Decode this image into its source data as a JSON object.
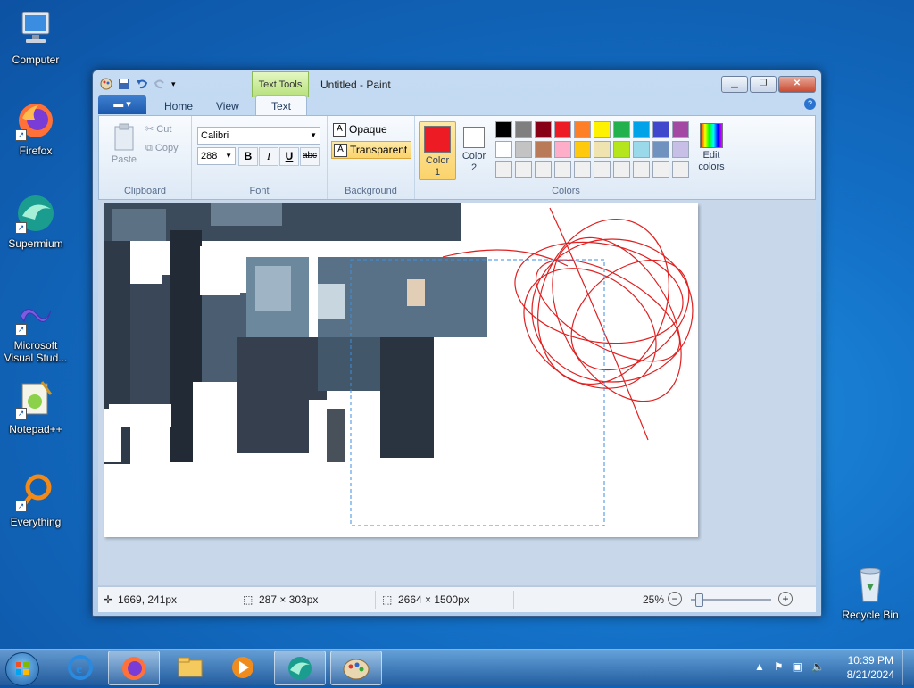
{
  "desktop": {
    "icons": [
      {
        "label": "Computer",
        "icon": "computer-icon"
      },
      {
        "label": "Firefox",
        "icon": "firefox-icon"
      },
      {
        "label": "Supermium",
        "icon": "supermium-icon"
      },
      {
        "label": "Microsoft Visual Stud...",
        "icon": "visual-studio-icon"
      },
      {
        "label": "Notepad++",
        "icon": "notepadpp-icon"
      },
      {
        "label": "Everything",
        "icon": "everything-icon"
      },
      {
        "label": "Recycle Bin",
        "icon": "recycle-bin-icon"
      }
    ]
  },
  "window": {
    "title": "Untitled - Paint",
    "context_tab": "Text Tools",
    "tabs": [
      "Home",
      "View",
      "Text"
    ],
    "active_tab": "Text",
    "help": "?"
  },
  "ribbon": {
    "clipboard": {
      "label": "Clipboard",
      "paste": "Paste",
      "cut": "Cut",
      "copy": "Copy"
    },
    "font": {
      "label": "Font",
      "family": "Calibri",
      "size": "288",
      "bold": "B",
      "italic": "I",
      "underline": "U",
      "strike": "abc"
    },
    "background": {
      "label": "Background",
      "opaque": "Opaque",
      "transparent": "Transparent",
      "selected": "Transparent"
    },
    "colors": {
      "label": "Colors",
      "color1_label": "Color 1",
      "color2_label": "Color 2",
      "color1": "#ed1c24",
      "color2": "#ffffff",
      "edit_label": "Edit colors",
      "palette": [
        "#000000",
        "#7f7f7f",
        "#880015",
        "#ed1c24",
        "#ff7f27",
        "#fff200",
        "#22b14c",
        "#00a2e8",
        "#3f48cc",
        "#a349a4",
        "#ffffff",
        "#c3c3c3",
        "#b97a57",
        "#ffaec9",
        "#ffc90e",
        "#efe4b0",
        "#b5e61d",
        "#99d9ea",
        "#7092be",
        "#c8bfe7",
        "#f0f0f0",
        "#f0f0f0",
        "#f0f0f0",
        "#f0f0f0",
        "#f0f0f0",
        "#f0f0f0",
        "#f0f0f0",
        "#f0f0f0",
        "#f0f0f0",
        "#f0f0f0"
      ]
    }
  },
  "statusbar": {
    "cursor_pos": "1669, 241px",
    "selection_size": "287 × 303px",
    "image_size": "2664 × 1500px",
    "zoom": "25%",
    "zoom_minus": "−",
    "zoom_plus": "+"
  },
  "taskbar": {
    "apps": [
      "internet-explorer-icon",
      "firefox-icon",
      "file-explorer-icon",
      "media-player-icon",
      "supermium-icon",
      "paint-icon"
    ],
    "time": "10:39 PM",
    "date": "8/21/2024"
  }
}
